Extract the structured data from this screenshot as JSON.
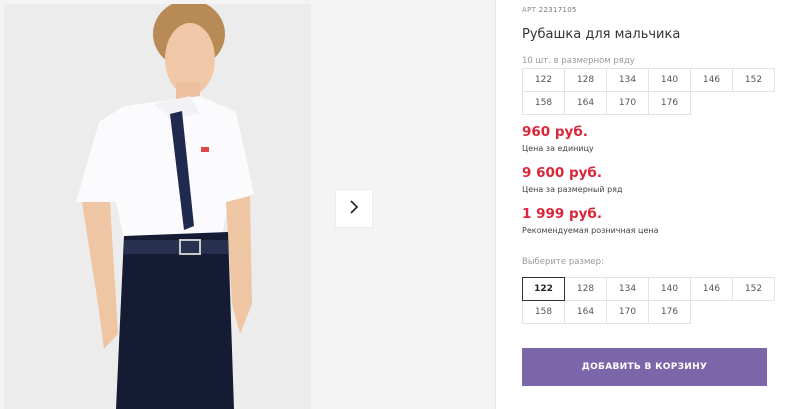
{
  "product": {
    "sku_label": "АРТ",
    "sku": "22317105",
    "title": "Рубашка для мальчика"
  },
  "pack": {
    "caption": "10 шт. в размерном ряду",
    "sizes": [
      "122",
      "128",
      "134",
      "140",
      "146",
      "152",
      "158",
      "164",
      "170",
      "176"
    ]
  },
  "prices": [
    {
      "value": "960 руб.",
      "label": "Цена за единицу"
    },
    {
      "value": "9 600 руб.",
      "label": "Цена за размерный ряд"
    },
    {
      "value": "1 999 руб.",
      "label": "Рекомендуемая розничная цена"
    }
  ],
  "size_select": {
    "caption": "Выберите размер:",
    "sizes": [
      "122",
      "128",
      "134",
      "140",
      "146",
      "152",
      "158",
      "164",
      "170",
      "176"
    ],
    "selected": "122"
  },
  "cart_button": "ДОБАВИТЬ В КОРЗИНУ",
  "icons": {
    "next": "chevron-right-icon"
  },
  "colors": {
    "accent": "#7a66a8",
    "price": "#d9263a"
  }
}
